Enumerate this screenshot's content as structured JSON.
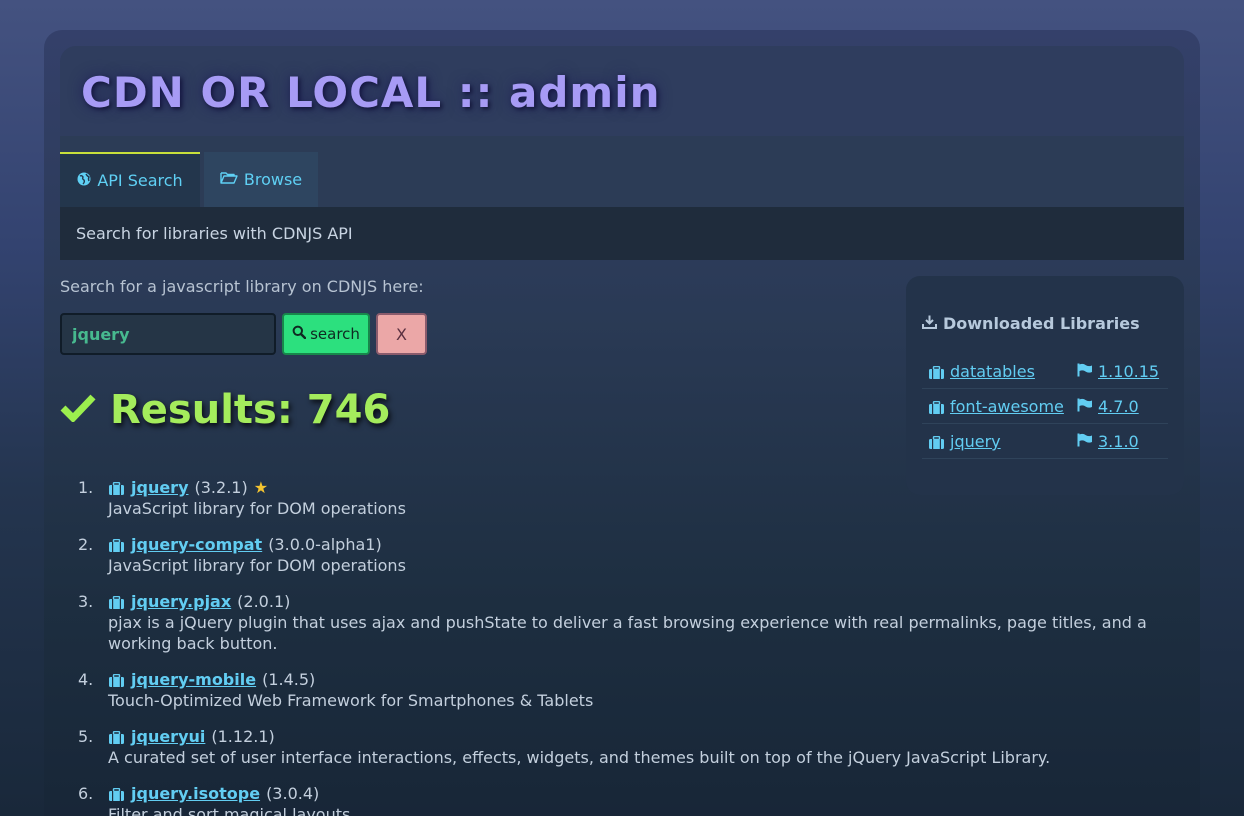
{
  "header": {
    "title": "CDN OR LOCAL :: admin"
  },
  "tabs": [
    {
      "label": "API Search",
      "icon": "globe-icon",
      "active": true
    },
    {
      "label": "Browse",
      "icon": "folder-open-icon",
      "active": false
    }
  ],
  "tab_panel": {
    "text": "Search for libraries with CDNJS API"
  },
  "search": {
    "prompt": "Search for a javascript library on CDNJS here:",
    "value": "jquery",
    "placeholder": "",
    "search_label": "search",
    "clear_label": "X"
  },
  "results": {
    "heading": "Results: 746",
    "items": [
      {
        "num": "1.",
        "name": "jquery",
        "version": "(3.2.1)",
        "starred": true,
        "description": "JavaScript library for DOM operations"
      },
      {
        "num": "2.",
        "name": "jquery-compat",
        "version": "(3.0.0-alpha1)",
        "starred": false,
        "description": "JavaScript library for DOM operations"
      },
      {
        "num": "3.",
        "name": "jquery.pjax",
        "version": "(2.0.1)",
        "starred": false,
        "description": "pjax is a jQuery plugin that uses ajax and pushState to deliver a fast browsing experience with real permalinks, page titles, and a working back button."
      },
      {
        "num": "4.",
        "name": "jquery-mobile",
        "version": "(1.4.5)",
        "starred": false,
        "description": "Touch-Optimized Web Framework for Smartphones & Tablets"
      },
      {
        "num": "5.",
        "name": "jqueryui",
        "version": "(1.12.1)",
        "starred": false,
        "description": "A curated set of user interface interactions, effects, widgets, and themes built on top of the jQuery JavaScript Library."
      },
      {
        "num": "6.",
        "name": "jquery.isotope",
        "version": "(3.0.4)",
        "starred": false,
        "description": "Filter and sort magical layouts"
      }
    ]
  },
  "sidebar": {
    "title": "Downloaded Libraries",
    "libraries": [
      {
        "name": "datatables",
        "version": "1.10.15"
      },
      {
        "name": "font-awesome",
        "version": "4.7.0"
      },
      {
        "name": "jquery",
        "version": "3.1.0"
      }
    ]
  },
  "colors": {
    "title": "#a79bf5",
    "link": "#62cdf2",
    "results": "#a4ec5c",
    "search_button": "#2ce07e",
    "clear_button": "#eba7a7",
    "active_tab_border": "#c7e03b"
  }
}
